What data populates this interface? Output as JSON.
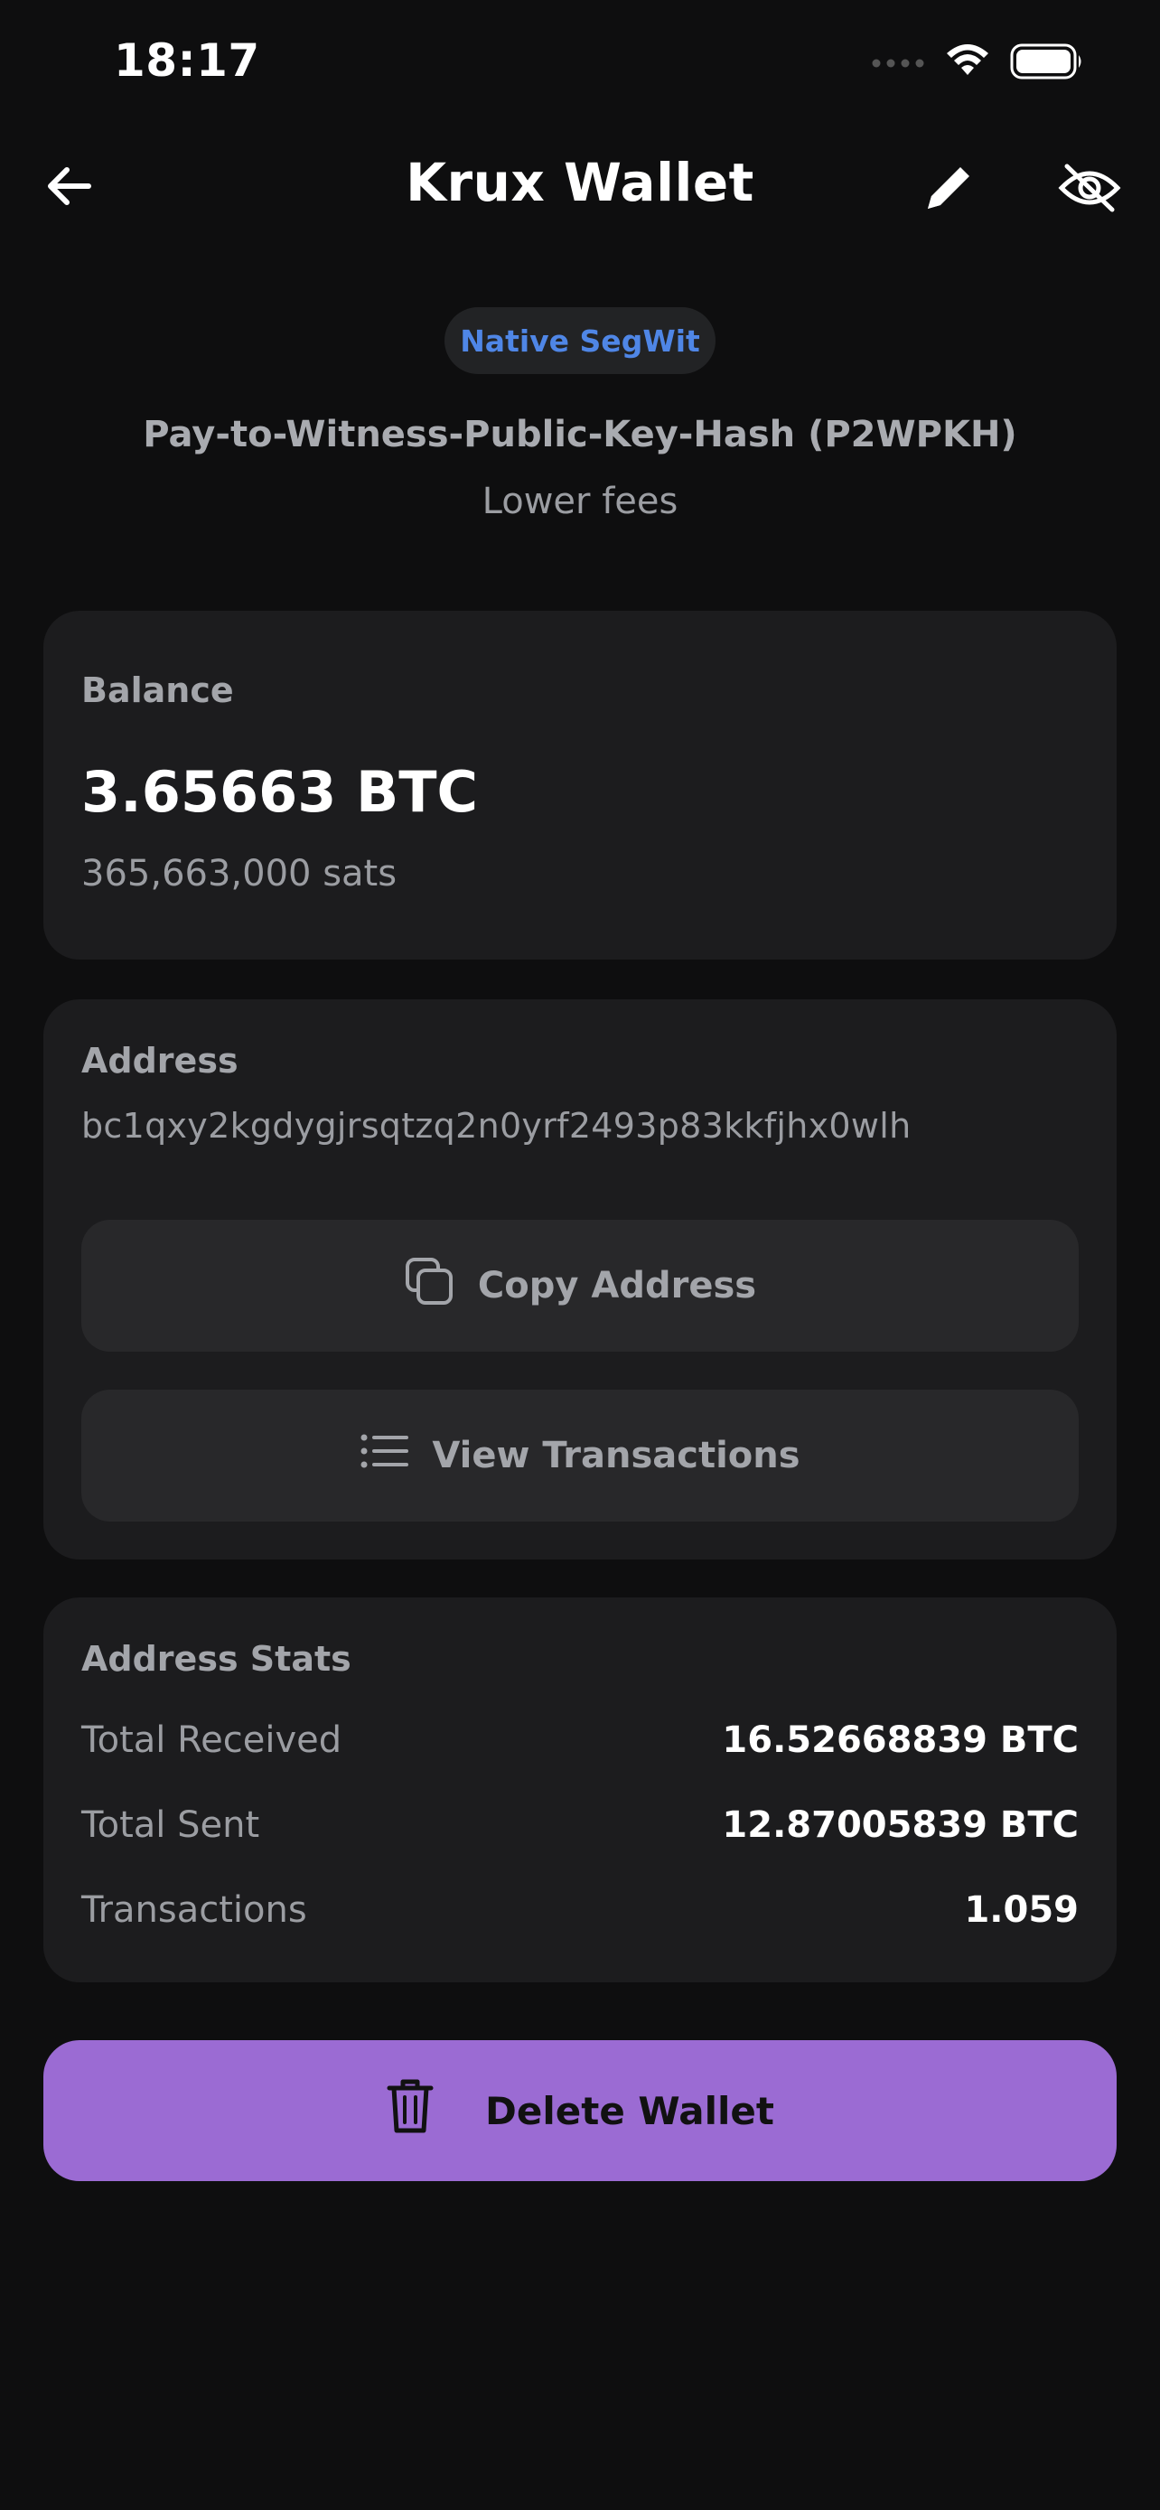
{
  "status_bar": {
    "time": "18:17",
    "signal_icon": "cellular-signal-dots-icon",
    "wifi_icon": "wifi-icon",
    "battery_icon": "battery-icon"
  },
  "header": {
    "title": "Krux Wallet",
    "back_icon": "arrow-left-icon",
    "edit_icon": "pencil-icon",
    "hide_icon": "eye-off-icon"
  },
  "address_type": {
    "badge": "Native SegWit",
    "description": "Pay-to-Witness-Public-Key-Hash (P2WPKH)",
    "note": "Lower fees"
  },
  "balance": {
    "label": "Balance",
    "btc": "3.65663 BTC",
    "sats": "365,663,000 sats"
  },
  "address": {
    "label": "Address",
    "value": "bc1qxy2kgdygjrsqtzq2n0yrf2493p83kkfjhx0wlh",
    "copy_label": "Copy Address",
    "copy_icon": "copy-icon",
    "view_label": "View Transactions",
    "view_icon": "list-icon"
  },
  "stats": {
    "title": "Address Stats",
    "rows": [
      {
        "label": "Total Received",
        "value": "16.52668839 BTC"
      },
      {
        "label": "Total Sent",
        "value": "12.87005839 BTC"
      },
      {
        "label": "Transactions",
        "value": "1.059"
      }
    ]
  },
  "delete": {
    "label": "Delete Wallet",
    "icon": "trash-icon"
  },
  "colors": {
    "background": "#0e0e0f",
    "card": "#1c1c1e",
    "button": "#28282a",
    "accent_blue": "#4f86e6",
    "delete_purple": "#9b6bd3"
  }
}
